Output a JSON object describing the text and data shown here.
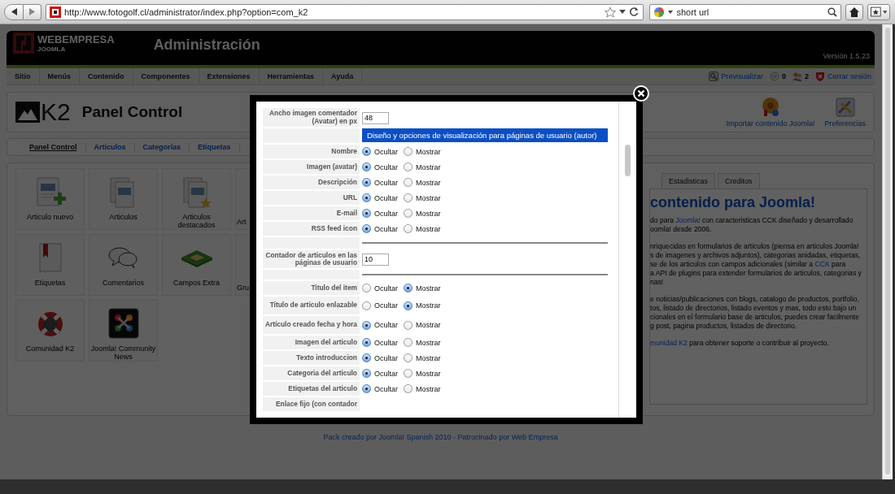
{
  "browser": {
    "url": "http://www.fotogolf.cl/administrator/index.php?option=com_k2",
    "search": "short url"
  },
  "header": {
    "brand": "WEBEMPRESA",
    "brand_sub": "JOOMLA",
    "title": "Administración",
    "version": "Versión 1.5.23"
  },
  "menu": [
    "Sitio",
    "Menús",
    "Contenido",
    "Componentes",
    "Extensiones",
    "Herramientas",
    "Ayuda"
  ],
  "status": [
    {
      "kind": "preview",
      "label": "Previsualizar",
      "link": true
    },
    {
      "kind": "messages",
      "label": "0",
      "link": false
    },
    {
      "kind": "users",
      "label": "2",
      "link": false
    },
    {
      "kind": "logout",
      "label": "Cerrar sesión",
      "link": true
    }
  ],
  "toolbar": {
    "logo_text": "K2",
    "title": "Panel Control",
    "buttons": [
      {
        "kind": "import",
        "label": "Importar contenido Joomla!"
      },
      {
        "kind": "preferences",
        "label": "Preferencias"
      }
    ]
  },
  "submenu": [
    {
      "label": "Panel Control",
      "selected": true
    },
    {
      "label": "Articulos",
      "selected": false
    },
    {
      "label": "Categorías",
      "selected": false
    },
    {
      "label": "Etiquetas",
      "selected": false
    }
  ],
  "shortcuts": [
    {
      "kind": "new",
      "label": "Articulo nuevo"
    },
    {
      "kind": "items",
      "label": "Articulos"
    },
    {
      "kind": "featured",
      "label": "Articulos destacados"
    },
    {
      "kind": "cut",
      "label": "Art"
    },
    {
      "kind": "tags",
      "label": "Etiquetas"
    },
    {
      "kind": "comments",
      "label": "Comentarios"
    },
    {
      "kind": "fields",
      "label": "Campos Extra"
    },
    {
      "kind": "cut",
      "label": "Gru"
    },
    {
      "kind": "community",
      "label": "Comunidad K2"
    },
    {
      "kind": "news",
      "label": "Joomla! Community News"
    }
  ],
  "info": {
    "tabs": [
      {
        "label": "Estadisticas",
        "selected": false
      },
      {
        "label": "Creditos",
        "selected": false
      }
    ],
    "heading": "contenido para Joomla!",
    "paragraphs": [
      [
        [
          {
            "text": "do para ",
            "link": false
          },
          {
            "text": "Joomla!",
            "link": true
          },
          {
            "text": " con caracteristicas CCK diseñado y desarrollado",
            "link": false
          }
        ],
        [
          {
            "text": "oomla! desde 2006.",
            "link": false
          }
        ]
      ],
      [
        [
          {
            "text": "nriquecidas en formularios de articulos (piensa en articulos Joomla!",
            "link": false
          }
        ],
        [
          {
            "text": "s de imagenes y archivos adjuntos), categorias anidadas, etiquetas,",
            "link": false
          }
        ],
        [
          {
            "text": "se de los articulos con campos adicionales (similar a ",
            "link": false
          },
          {
            "text": "CCK",
            "link": true
          },
          {
            "text": " para",
            "link": false
          }
        ],
        [
          {
            "text": "a API de plugins para extender formularios de articulos, categorias y",
            "link": false
          }
        ],
        [
          {
            "text": "nas!",
            "link": false
          }
        ]
      ],
      [
        [
          {
            "text": "e noticias/publicaciones con blogs, catalogo de productos, portfolio,",
            "link": false
          }
        ],
        [
          {
            "text": "tos, listado de directorios, listado eventos y mas, todo esto bajo un",
            "link": false
          }
        ],
        [
          {
            "text": "cionales en el formulario base de articulos, puedes crear facilmente",
            "link": false
          }
        ],
        [
          {
            "text": "g post, pagina productos, listados de directorio.",
            "link": false
          }
        ]
      ],
      [
        [
          {
            "text": "munidad K2",
            "link": true
          },
          {
            "text": " para obtener soporte o contribuir al proyecto.",
            "link": false
          }
        ]
      ]
    ]
  },
  "footer": "Pack creado por Joomla! Spanish 2010 - Patrocinado por Web Empresa",
  "modal": {
    "rows": [
      {
        "kind": "input",
        "label": "Ancho imagen comentador (Avatar) en px",
        "value": "48"
      },
      {
        "kind": "header",
        "text": "Diseño y opciones de visualización para páginas de usuario (autor)"
      },
      {
        "kind": "radio",
        "label": "Nombre",
        "options": [
          {
            "label": "Ocultar",
            "selected": true
          },
          {
            "label": "Mostrar",
            "selected": false
          }
        ]
      },
      {
        "kind": "radio",
        "label": "Imagen (avatar)",
        "options": [
          {
            "label": "Ocultar",
            "selected": true
          },
          {
            "label": "Mostrar",
            "selected": false
          }
        ]
      },
      {
        "kind": "radio",
        "label": "Descripción",
        "options": [
          {
            "label": "Ocultar",
            "selected": true
          },
          {
            "label": "Mostrar",
            "selected": false
          }
        ]
      },
      {
        "kind": "radio",
        "label": "URL",
        "options": [
          {
            "label": "Ocultar",
            "selected": true
          },
          {
            "label": "Mostrar",
            "selected": false
          }
        ]
      },
      {
        "kind": "radio",
        "label": "E-mail",
        "options": [
          {
            "label": "Ocultar",
            "selected": true
          },
          {
            "label": "Mostrar",
            "selected": false
          }
        ]
      },
      {
        "kind": "radio",
        "label": "RSS feed icon",
        "options": [
          {
            "label": "Ocultar",
            "selected": true
          },
          {
            "label": "Mostrar",
            "selected": false
          }
        ]
      },
      {
        "kind": "rule"
      },
      {
        "kind": "input",
        "label": "Contador de articulos en las páginas de usuario",
        "value": "10"
      },
      {
        "kind": "rule"
      },
      {
        "kind": "radio",
        "label": "Titulo del item",
        "options": [
          {
            "label": "Ocultar",
            "selected": false
          },
          {
            "label": "Mostrar",
            "selected": true
          }
        ]
      },
      {
        "kind": "radio",
        "label": "Titulo de articulo enlazable",
        "options": [
          {
            "label": "Ocultar",
            "selected": false
          },
          {
            "label": "Mostrar",
            "selected": true
          }
        ]
      },
      {
        "kind": "radio",
        "label": "Artículo creado fecha y hora",
        "options": [
          {
            "label": "Ocultar",
            "selected": true
          },
          {
            "label": "Mostrar",
            "selected": false
          }
        ]
      },
      {
        "kind": "radio",
        "label": "Imagen del articulo",
        "options": [
          {
            "label": "Ocultar",
            "selected": true
          },
          {
            "label": "Mostrar",
            "selected": false
          }
        ]
      },
      {
        "kind": "radio",
        "label": "Texto introduccion",
        "options": [
          {
            "label": "Ocultar",
            "selected": true
          },
          {
            "label": "Mostrar",
            "selected": false
          }
        ]
      },
      {
        "kind": "radio",
        "label": "Categoria del articulo",
        "options": [
          {
            "label": "Ocultar",
            "selected": true
          },
          {
            "label": "Mostrar",
            "selected": false
          }
        ]
      },
      {
        "kind": "radio",
        "label": "Etiquetas del articulo",
        "options": [
          {
            "label": "Ocultar",
            "selected": true
          },
          {
            "label": "Mostrar",
            "selected": false
          }
        ]
      },
      {
        "kind": "label",
        "label": "Enlace fijo (con contador"
      }
    ]
  }
}
